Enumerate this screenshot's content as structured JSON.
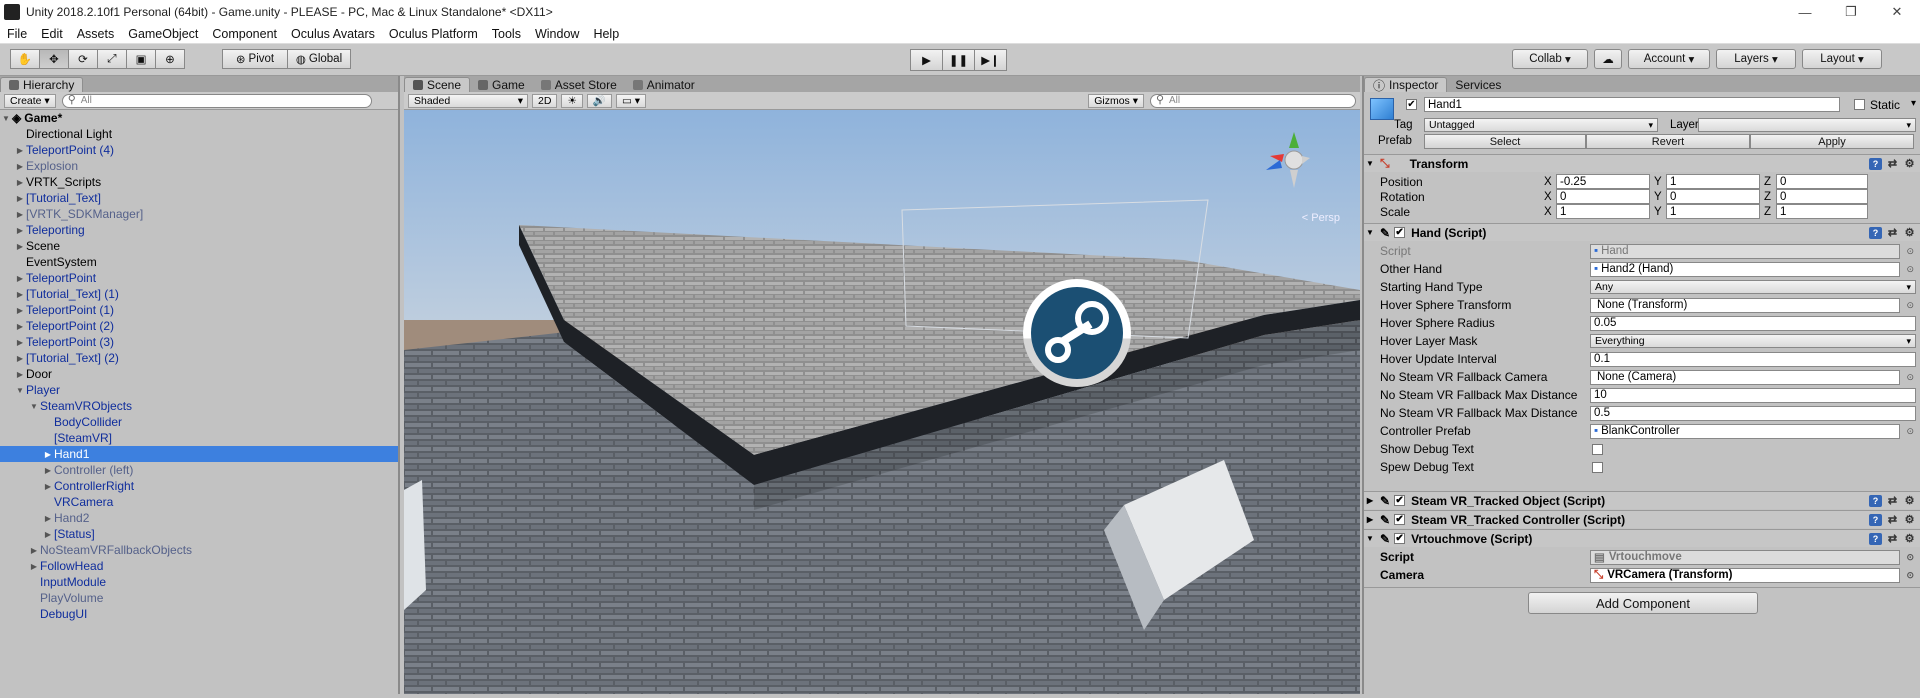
{
  "window": {
    "title": "Unity 2018.2.10f1 Personal (64bit) - Game.unity - PLEASE - PC, Mac & Linux Standalone* <DX11>"
  },
  "menu": [
    "File",
    "Edit",
    "Assets",
    "GameObject",
    "Component",
    "Oculus Avatars",
    "Oculus Platform",
    "Tools",
    "Window",
    "Help"
  ],
  "toolbar": {
    "pivot": "Pivot",
    "global": "Global",
    "collab": "Collab",
    "account": "Account",
    "layers": "Layers",
    "layout": "Layout"
  },
  "hierarchy": {
    "tab": "Hierarchy",
    "create": "Create",
    "search_placeholder": "All",
    "scene_name": "Game*",
    "items": [
      {
        "label": "Directional Light",
        "indent": 1,
        "arrow": "",
        "style": "normal"
      },
      {
        "label": "TeleportPoint (4)",
        "indent": 1,
        "arrow": "▶",
        "style": "blue"
      },
      {
        "label": "Explosion",
        "indent": 1,
        "arrow": "▶",
        "style": "grey"
      },
      {
        "label": "VRTK_Scripts",
        "indent": 1,
        "arrow": "▶",
        "style": "normal"
      },
      {
        "label": "[Tutorial_Text]",
        "indent": 1,
        "arrow": "▶",
        "style": "blue"
      },
      {
        "label": "[VRTK_SDKManager]",
        "indent": 1,
        "arrow": "▶",
        "style": "grey"
      },
      {
        "label": "Teleporting",
        "indent": 1,
        "arrow": "▶",
        "style": "blue"
      },
      {
        "label": "Scene",
        "indent": 1,
        "arrow": "▶",
        "style": "normal"
      },
      {
        "label": "EventSystem",
        "indent": 1,
        "arrow": "",
        "style": "normal"
      },
      {
        "label": "TeleportPoint",
        "indent": 1,
        "arrow": "▶",
        "style": "blue"
      },
      {
        "label": "[Tutorial_Text] (1)",
        "indent": 1,
        "arrow": "▶",
        "style": "blue"
      },
      {
        "label": "TeleportPoint (1)",
        "indent": 1,
        "arrow": "▶",
        "style": "blue"
      },
      {
        "label": "TeleportPoint (2)",
        "indent": 1,
        "arrow": "▶",
        "style": "blue"
      },
      {
        "label": "TeleportPoint (3)",
        "indent": 1,
        "arrow": "▶",
        "style": "blue"
      },
      {
        "label": "[Tutorial_Text] (2)",
        "indent": 1,
        "arrow": "▶",
        "style": "blue"
      },
      {
        "label": "Door",
        "indent": 1,
        "arrow": "▶",
        "style": "normal"
      },
      {
        "label": "Player",
        "indent": 1,
        "arrow": "▼",
        "style": "blue"
      },
      {
        "label": "SteamVRObjects",
        "indent": 2,
        "arrow": "▼",
        "style": "blue"
      },
      {
        "label": "BodyCollider",
        "indent": 3,
        "arrow": "",
        "style": "blue"
      },
      {
        "label": "[SteamVR]",
        "indent": 3,
        "arrow": "",
        "style": "blue"
      },
      {
        "label": "Hand1",
        "indent": 3,
        "arrow": "▶",
        "style": "sel"
      },
      {
        "label": "Controller (left)",
        "indent": 3,
        "arrow": "▶",
        "style": "grey"
      },
      {
        "label": "ControllerRight",
        "indent": 3,
        "arrow": "▶",
        "style": "blue"
      },
      {
        "label": "VRCamera",
        "indent": 3,
        "arrow": "",
        "style": "blue"
      },
      {
        "label": "Hand2",
        "indent": 3,
        "arrow": "▶",
        "style": "grey"
      },
      {
        "label": "[Status]",
        "indent": 3,
        "arrow": "▶",
        "style": "blue"
      },
      {
        "label": "NoSteamVRFallbackObjects",
        "indent": 2,
        "arrow": "▶",
        "style": "grey"
      },
      {
        "label": "FollowHead",
        "indent": 2,
        "arrow": "▶",
        "style": "blue"
      },
      {
        "label": "InputModule",
        "indent": 2,
        "arrow": "",
        "style": "blue"
      },
      {
        "label": "PlayVolume",
        "indent": 2,
        "arrow": "",
        "style": "grey"
      },
      {
        "label": "DebugUI",
        "indent": 2,
        "arrow": "",
        "style": "blue"
      }
    ]
  },
  "scene": {
    "tabs": [
      "Scene",
      "Game",
      "Asset Store",
      "Animator"
    ],
    "shading": "Shaded",
    "mode2d": "2D",
    "gizmos": "Gizmos",
    "search_placeholder": "All",
    "persp_label": "< Persp"
  },
  "inspector": {
    "tabs": [
      "Inspector",
      "Services"
    ],
    "object_name": "Hand1",
    "static_label": "Static",
    "tag_label": "Tag",
    "tag_value": "Untagged",
    "layer_label": "Layer",
    "layer_value": "",
    "prefab_label": "Prefab",
    "prefab_select": "Select",
    "prefab_revert": "Revert",
    "prefab_apply": "Apply",
    "transform": {
      "title": "Transform",
      "position_label": "Position",
      "position": [
        "-0.25",
        "1",
        "0"
      ],
      "rotation_label": "Rotation",
      "rotation": [
        "0",
        "0",
        "0"
      ],
      "scale_label": "Scale",
      "scale": [
        "1",
        "1",
        "1"
      ],
      "axes": [
        "X",
        "Y",
        "Z"
      ]
    },
    "hand_script": {
      "title": "Hand (Script)",
      "fields": [
        {
          "label": "Script",
          "value": "Hand",
          "kind": "ref",
          "dim": true
        },
        {
          "label": "Other Hand",
          "value": "Hand2 (Hand)",
          "kind": "ref"
        },
        {
          "label": "Starting Hand Type",
          "value": "Any",
          "kind": "drop"
        },
        {
          "label": "Hover Sphere Transform",
          "value": "None (Transform)",
          "kind": "ref"
        },
        {
          "label": "Hover Sphere Radius",
          "value": "0.05",
          "kind": "text"
        },
        {
          "label": "Hover Layer Mask",
          "value": "Everything",
          "kind": "drop"
        },
        {
          "label": "Hover Update Interval",
          "value": "0.1",
          "kind": "text"
        },
        {
          "label": "No Steam VR Fallback Camera",
          "value": "None (Camera)",
          "kind": "ref"
        },
        {
          "label": "No Steam VR Fallback Max Distance",
          "value": "10",
          "kind": "text"
        },
        {
          "label": "No Steam VR Fallback Max Distance",
          "value": "0.5",
          "kind": "text"
        },
        {
          "label": "Controller Prefab",
          "value": "BlankController",
          "kind": "ref"
        },
        {
          "label": "Show Debug Text",
          "value": "",
          "kind": "check"
        },
        {
          "label": "Spew Debug Text",
          "value": "",
          "kind": "check"
        }
      ]
    },
    "tracked_object": "Steam VR_Tracked Object (Script)",
    "tracked_controller": "Steam VR_Tracked Controller (Script)",
    "vrtouch": {
      "title": "Vrtouchmove (Script)",
      "script_label": "Script",
      "script_value": "Vrtouchmove",
      "camera_label": "Camera",
      "camera_value": "VRCamera (Transform)"
    },
    "add_component": "Add Component"
  }
}
